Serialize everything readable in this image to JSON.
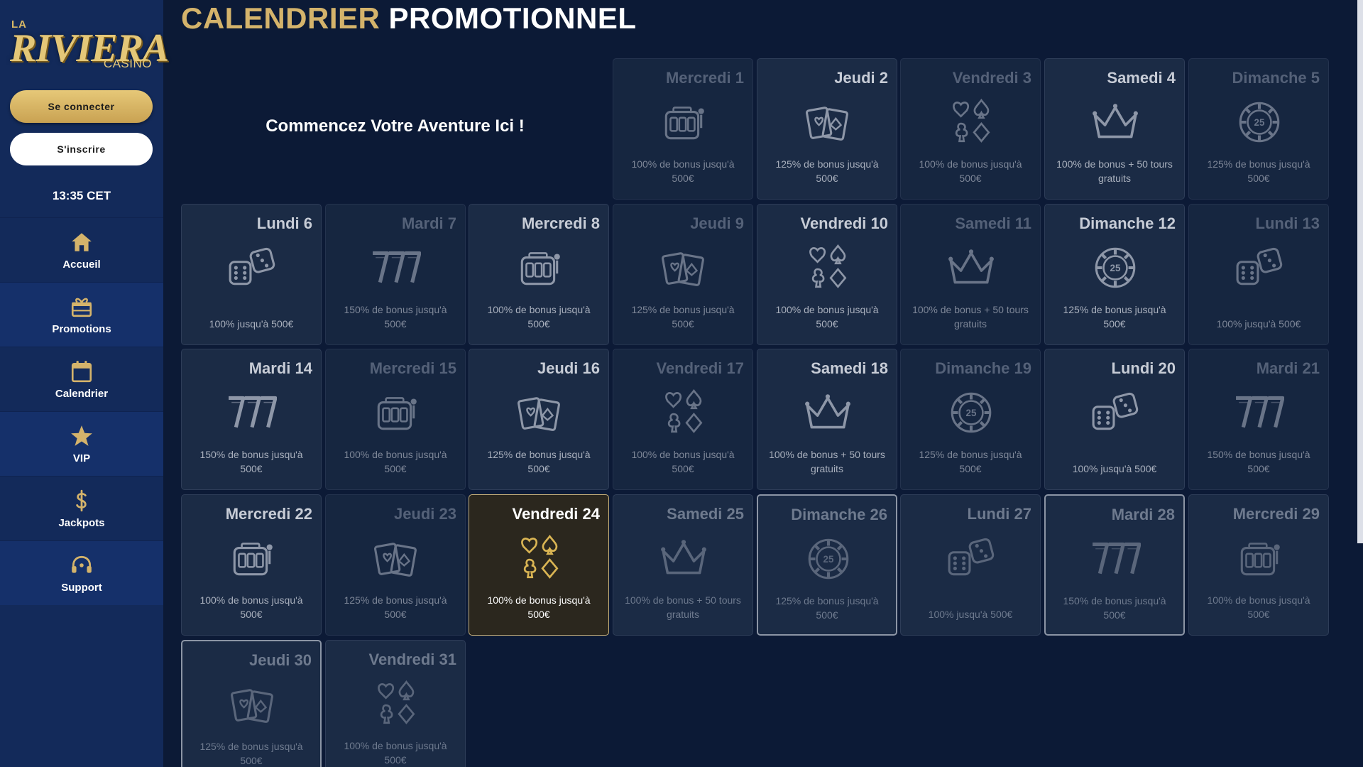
{
  "brand": {
    "la": "LA",
    "name": "RIVIERA",
    "sub": "CASINO"
  },
  "auth": {
    "login_label": "Se connecter",
    "register_label": "S'inscrire"
  },
  "clock": "13:35 CET",
  "nav": [
    {
      "label": "Accueil",
      "icon": "home-icon"
    },
    {
      "label": "Promotions",
      "icon": "gift-icon"
    },
    {
      "label": "Calendrier",
      "icon": "calendar-icon"
    },
    {
      "label": "VIP",
      "icon": "star-icon"
    },
    {
      "label": "Jackpots",
      "icon": "dollar-icon"
    },
    {
      "label": "Support",
      "icon": "headset-icon"
    }
  ],
  "page": {
    "title_gold": "CALENDRIER",
    "title_white": "PROMOTIONNEL",
    "hero": "Commencez Votre Aventure Ici !"
  },
  "colors": {
    "gold": "#d4b36b",
    "sidebar": "#132a5a",
    "background": "#0c1a36",
    "card": "#1b2b45"
  },
  "calendar": [
    {
      "title": "Mercredi 1",
      "desc": "100% de bonus jusqu'à 500€",
      "icon": "slot-machine-icon",
      "state": "dim"
    },
    {
      "title": "Jeudi 2",
      "desc": "125% de bonus jusqu'à 500€",
      "icon": "cards-icon",
      "state": "normal"
    },
    {
      "title": "Vendredi 3",
      "desc": "100% de bonus jusqu'à 500€",
      "icon": "card-suits-icon",
      "state": "dim"
    },
    {
      "title": "Samedi 4",
      "desc": "100% de bonus + 50 tours gratuits",
      "icon": "crown-icon",
      "state": "normal"
    },
    {
      "title": "Dimanche 5",
      "desc": "125% de bonus jusqu'à 500€",
      "icon": "chip-icon",
      "state": "dim"
    },
    {
      "title": "Lundi 6",
      "desc": "100% jusqu'à 500€",
      "icon": "dice-icon",
      "state": "normal"
    },
    {
      "title": "Mardi 7",
      "desc": "150% de bonus jusqu'à 500€",
      "icon": "triple-seven-icon",
      "state": "dim"
    },
    {
      "title": "Mercredi 8",
      "desc": "100% de bonus jusqu'à 500€",
      "icon": "slot-machine-icon",
      "state": "normal"
    },
    {
      "title": "Jeudi 9",
      "desc": "125% de bonus jusqu'à 500€",
      "icon": "cards-icon",
      "state": "dim"
    },
    {
      "title": "Vendredi 10",
      "desc": "100% de bonus jusqu'à 500€",
      "icon": "card-suits-icon",
      "state": "normal"
    },
    {
      "title": "Samedi 11",
      "desc": "100% de bonus + 50 tours gratuits",
      "icon": "crown-icon",
      "state": "dim"
    },
    {
      "title": "Dimanche 12",
      "desc": "125% de bonus jusqu'à 500€",
      "icon": "chip-icon",
      "state": "normal"
    },
    {
      "title": "Lundi 13",
      "desc": "100% jusqu'à 500€",
      "icon": "dice-icon",
      "state": "dim"
    },
    {
      "title": "Mardi 14",
      "desc": "150% de bonus jusqu'à 500€",
      "icon": "triple-seven-icon",
      "state": "normal"
    },
    {
      "title": "Mercredi 15",
      "desc": "100% de bonus jusqu'à 500€",
      "icon": "slot-machine-icon",
      "state": "dim"
    },
    {
      "title": "Jeudi 16",
      "desc": "125% de bonus jusqu'à 500€",
      "icon": "cards-icon",
      "state": "normal"
    },
    {
      "title": "Vendredi 17",
      "desc": "100% de bonus jusqu'à 500€",
      "icon": "card-suits-icon",
      "state": "dim"
    },
    {
      "title": "Samedi 18",
      "desc": "100% de bonus + 50 tours gratuits",
      "icon": "crown-icon",
      "state": "normal"
    },
    {
      "title": "Dimanche 19",
      "desc": "125% de bonus jusqu'à 500€",
      "icon": "chip-icon",
      "state": "dim"
    },
    {
      "title": "Lundi 20",
      "desc": "100% jusqu'à 500€",
      "icon": "dice-icon",
      "state": "normal"
    },
    {
      "title": "Mardi 21",
      "desc": "150% de bonus jusqu'à 500€",
      "icon": "triple-seven-icon",
      "state": "dim"
    },
    {
      "title": "Mercredi 22",
      "desc": "100% de bonus jusqu'à 500€",
      "icon": "slot-machine-icon",
      "state": "normal"
    },
    {
      "title": "Jeudi 23",
      "desc": "125% de bonus jusqu'à 500€",
      "icon": "cards-icon",
      "state": "dim"
    },
    {
      "title": "Vendredi 24",
      "desc": "100% de bonus jusqu'à 500€",
      "icon": "card-suits-icon",
      "state": "active"
    },
    {
      "title": "Samedi 25",
      "desc": "100% de bonus + 50 tours gratuits",
      "icon": "crown-icon",
      "state": "past"
    },
    {
      "title": "Dimanche 26",
      "desc": "125% de bonus jusqu'à 500€",
      "icon": "chip-icon",
      "state": "past-hl"
    },
    {
      "title": "Lundi 27",
      "desc": "100% jusqu'à 500€",
      "icon": "dice-icon",
      "state": "past"
    },
    {
      "title": "Mardi 28",
      "desc": "150% de bonus jusqu'à 500€",
      "icon": "triple-seven-icon",
      "state": "past-hl"
    },
    {
      "title": "Mercredi 29",
      "desc": "100% de bonus jusqu'à 500€",
      "icon": "slot-machine-icon",
      "state": "past"
    },
    {
      "title": "Jeudi 30",
      "desc": "125% de bonus jusqu'à 500€",
      "icon": "cards-icon",
      "state": "past-hl"
    },
    {
      "title": "Vendredi 31",
      "desc": "100% de bonus jusqu'à 500€",
      "icon": "card-suits-icon",
      "state": "past"
    }
  ]
}
